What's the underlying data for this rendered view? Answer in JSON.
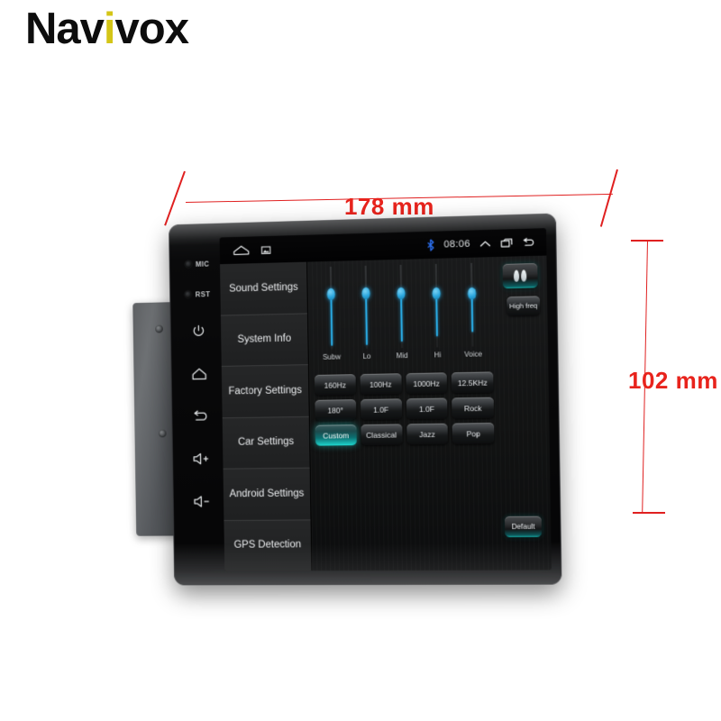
{
  "brand": {
    "prefix": "Nav",
    "accent": "i",
    "suffix": "vox",
    "accent_color": "#d4c517"
  },
  "dimensions": {
    "width_label": "178 mm",
    "height_label": "102 mm",
    "annotation_color": "#e8231c"
  },
  "device": {
    "bezel": {
      "mic_label": "MIC",
      "reset_label": "RST",
      "buttons": [
        {
          "name": "power-button",
          "icon": "power-icon"
        },
        {
          "name": "home-button",
          "icon": "home-icon"
        },
        {
          "name": "back-button",
          "icon": "back-arrow-icon"
        },
        {
          "name": "volume-up-button",
          "icon": "volume-up-icon"
        },
        {
          "name": "volume-down-button",
          "icon": "volume-down-icon"
        }
      ]
    },
    "statusbar": {
      "home_icon": "home-icon",
      "screenshot_icon": "screenshot-icon",
      "bluetooth_icon": "bluetooth-icon",
      "bluetooth_color": "#2b6ff0",
      "clock": "08:06",
      "expand_icon": "chevron-up-icon",
      "recents_icon": "recents-icon",
      "back_icon": "back-arrow-icon"
    },
    "sidebar": {
      "items": [
        {
          "label": "Sound Settings",
          "name": "sidebar-item-sound-settings"
        },
        {
          "label": "System Info",
          "name": "sidebar-item-system-info"
        },
        {
          "label": "Factory Settings",
          "name": "sidebar-item-factory-settings"
        },
        {
          "label": "Car Settings",
          "name": "sidebar-item-car-settings"
        },
        {
          "label": "Android Settings",
          "name": "sidebar-item-android-settings"
        },
        {
          "label": "GPS Detection",
          "name": "sidebar-item-gps-detection"
        }
      ]
    },
    "equalizer": {
      "accent_color": "#29a8e0",
      "sliders": [
        {
          "label": "Subw",
          "value": 52
        },
        {
          "label": "Lo",
          "value": 52
        },
        {
          "label": "Mid",
          "value": 54
        },
        {
          "label": "Hi",
          "value": 58
        },
        {
          "label": "Voice",
          "value": 60
        }
      ],
      "balance_button": {
        "name": "balance-fader-button",
        "icon": "balance-icon"
      },
      "high_freq_button": "High freq",
      "default_button": "Default",
      "rows": [
        [
          {
            "label": "160Hz",
            "active": false
          },
          {
            "label": "100Hz",
            "active": false
          },
          {
            "label": "1000Hz",
            "active": false
          },
          {
            "label": "12.5KHz",
            "active": false
          }
        ],
        [
          {
            "label": "180°",
            "active": false
          },
          {
            "label": "1.0F",
            "active": false
          },
          {
            "label": "1.0F",
            "active": false
          },
          {
            "label": "Rock",
            "active": false
          }
        ],
        [
          {
            "label": "Custom",
            "active": true
          },
          {
            "label": "Classical",
            "active": false
          },
          {
            "label": "Jazz",
            "active": false
          },
          {
            "label": "Pop",
            "active": false
          }
        ]
      ]
    }
  }
}
